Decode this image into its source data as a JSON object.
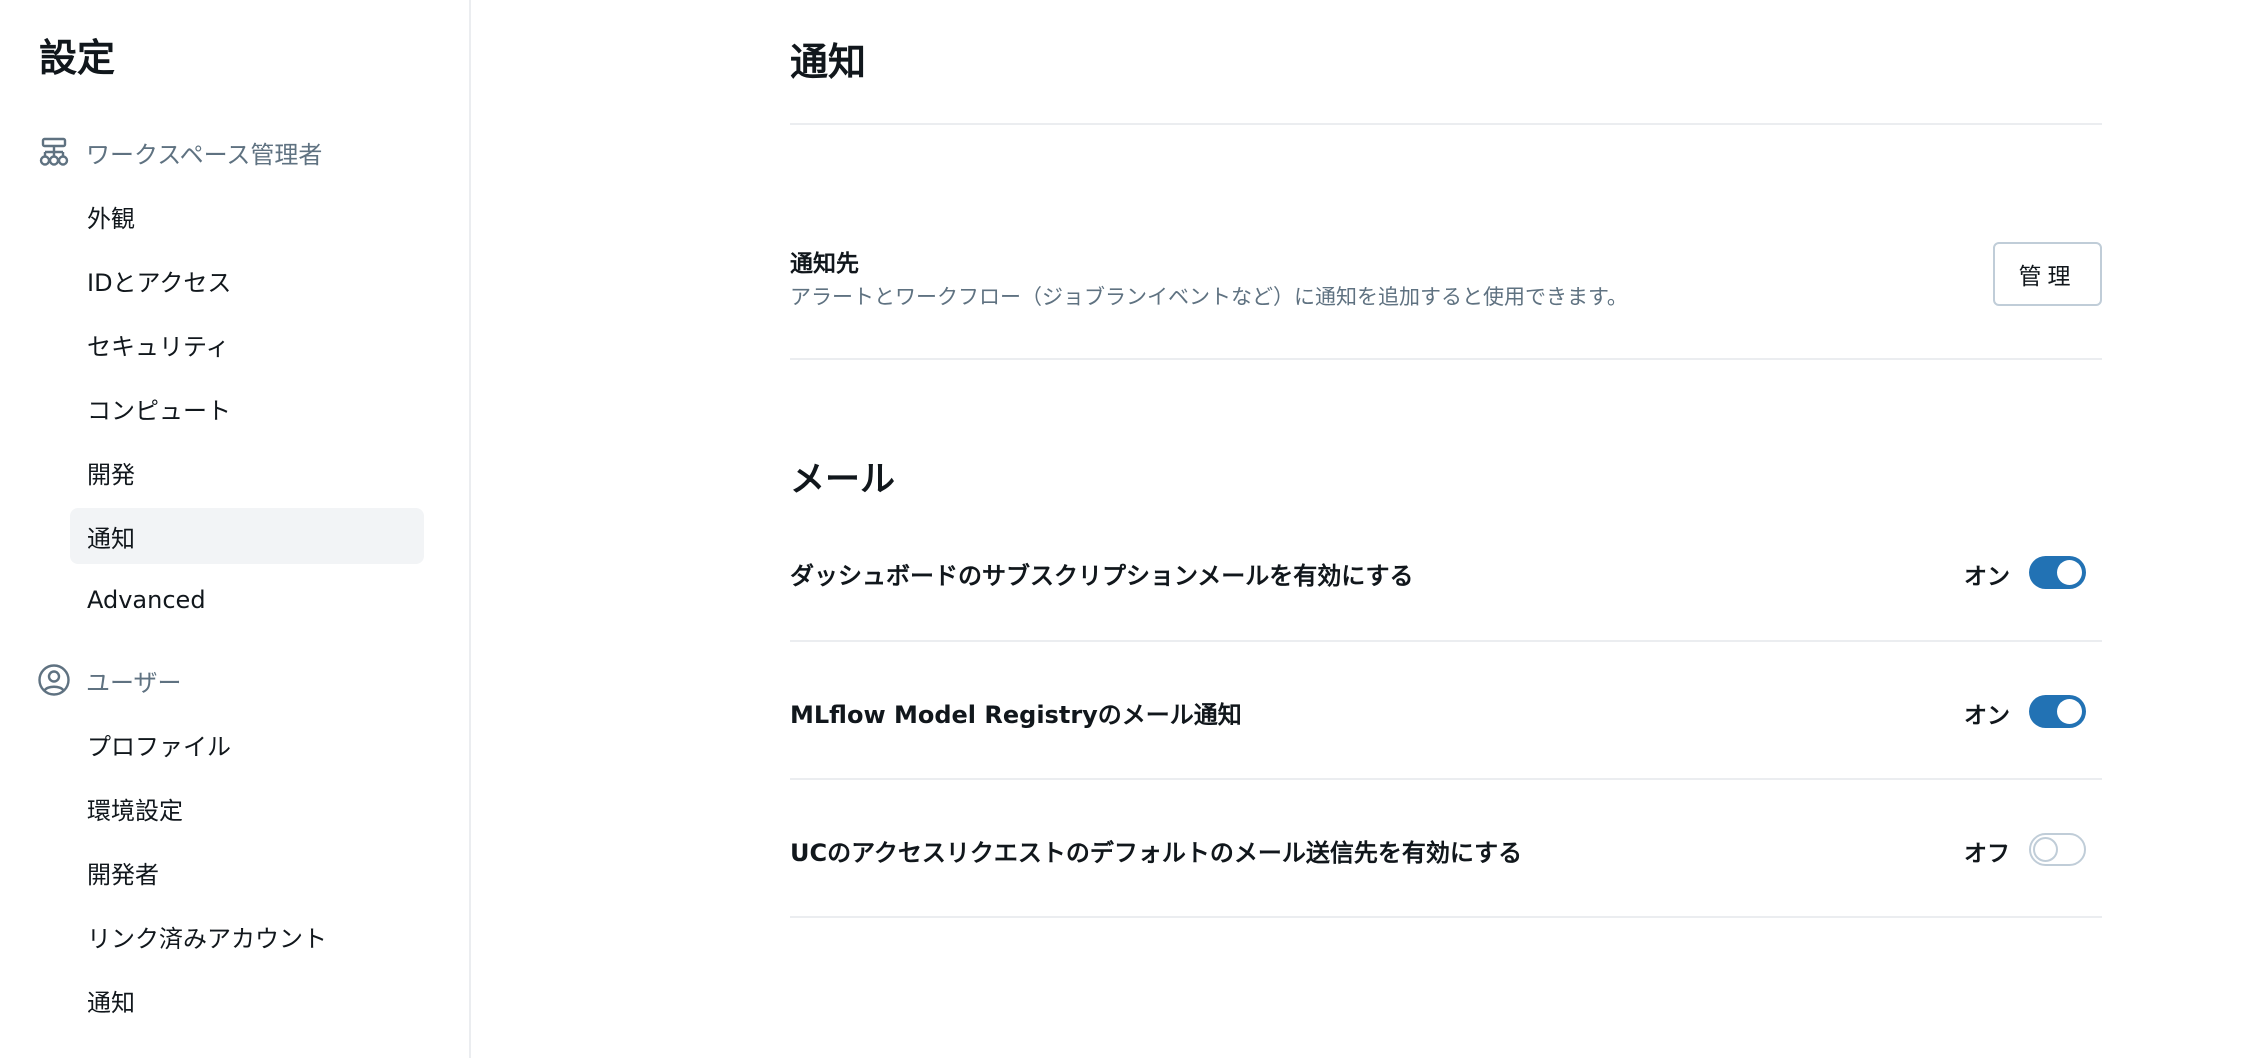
{
  "sidebar": {
    "title": "設定",
    "groups": [
      {
        "label": "ワークスペース管理者",
        "icon": "workspace-admin-icon",
        "items": [
          {
            "label": "外観"
          },
          {
            "label": "IDとアクセス"
          },
          {
            "label": "セキュリティ"
          },
          {
            "label": "コンピュート"
          },
          {
            "label": "開発"
          },
          {
            "label": "通知",
            "active": true
          },
          {
            "label": "Advanced"
          }
        ]
      },
      {
        "label": "ユーザー",
        "icon": "user-circle-icon",
        "items": [
          {
            "label": "プロファイル"
          },
          {
            "label": "環境設定"
          },
          {
            "label": "開発者"
          },
          {
            "label": "リンク済みアカウント"
          },
          {
            "label": "通知"
          }
        ]
      }
    ]
  },
  "main": {
    "title": "通知",
    "destinations": {
      "title": "通知先",
      "description": "アラートとワークフロー（ジョブランイベントなど）に通知を追加すると使用できます。",
      "manage_label": "管理"
    },
    "email": {
      "title": "メール",
      "rows": [
        {
          "label": "ダッシュボードのサブスクリプションメールを有効にする",
          "state": "オン",
          "on": true
        },
        {
          "label": "MLflow Model Registryのメール通知",
          "state": "オン",
          "on": true
        },
        {
          "label": "UCのアクセスリクエストのデフォルトのメール送信先を有効にする",
          "state": "オフ",
          "on": false
        }
      ]
    }
  },
  "colors": {
    "accent": "#2272b4",
    "muted_text": "#5f7281",
    "divider": "#ebedf0",
    "active_bg": "#f2f4f6"
  }
}
